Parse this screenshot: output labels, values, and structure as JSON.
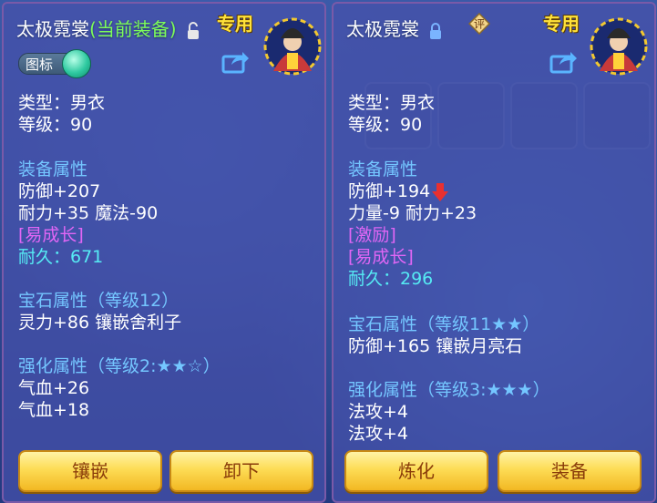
{
  "left_panel": {
    "title": "太极霓裳",
    "current_tag": "(当前装备)",
    "exclusive": "专用",
    "icon_toggle_label": "图标",
    "lines": [
      {
        "text": "类型：男衣",
        "color": "w"
      },
      {
        "text": "等级：90",
        "color": "w"
      },
      {
        "text": "装备属性",
        "color": "sec"
      },
      {
        "text": "防御+207",
        "color": "w"
      },
      {
        "text": "耐力+35 魔法-90",
        "color": "w"
      },
      {
        "text": "[易成长]",
        "color": "pur"
      },
      {
        "text": "耐久：671",
        "color": "cy"
      },
      {
        "text": "宝石属性（等级12）",
        "color": "sec"
      },
      {
        "text": "灵力+86 镶嵌舍利子",
        "color": "w"
      },
      {
        "text": "强化属性（等级2:★★☆）",
        "color": "sec"
      },
      {
        "text": "气血+26",
        "color": "w"
      },
      {
        "text": "气血+18",
        "color": "w"
      }
    ],
    "buttons": [
      "镶嵌",
      "卸下"
    ]
  },
  "right_panel": {
    "title": "太极霓裳",
    "rate_badge": "评",
    "exclusive": "专用",
    "lines": [
      {
        "text": "类型：男衣",
        "color": "w"
      },
      {
        "text": "等级：90",
        "color": "w"
      },
      {
        "text": "装备属性",
        "color": "sec"
      },
      {
        "text": "防御+194",
        "color": "w"
      },
      {
        "text": "力量-9 耐力+23",
        "color": "w"
      },
      {
        "text": "[激励]",
        "color": "pur"
      },
      {
        "text": "[易成长]",
        "color": "pur"
      },
      {
        "text": "耐久：296",
        "color": "cy"
      },
      {
        "text": "宝石属性（等级11★★）",
        "color": "sec"
      },
      {
        "text": "防御+165 镶嵌月亮石",
        "color": "w"
      },
      {
        "text": "强化属性（等级3:★★★）",
        "color": "sec"
      },
      {
        "text": "法攻+4",
        "color": "w"
      },
      {
        "text": "法攻+4",
        "color": "w"
      }
    ],
    "buttons": [
      "炼化",
      "装备"
    ]
  },
  "colors": {
    "section": "#74c6ff",
    "special": "#e066f5",
    "durability": "#56ecf4",
    "current_tag": "#7dfc5a",
    "exclusive": "#ffe23a"
  }
}
